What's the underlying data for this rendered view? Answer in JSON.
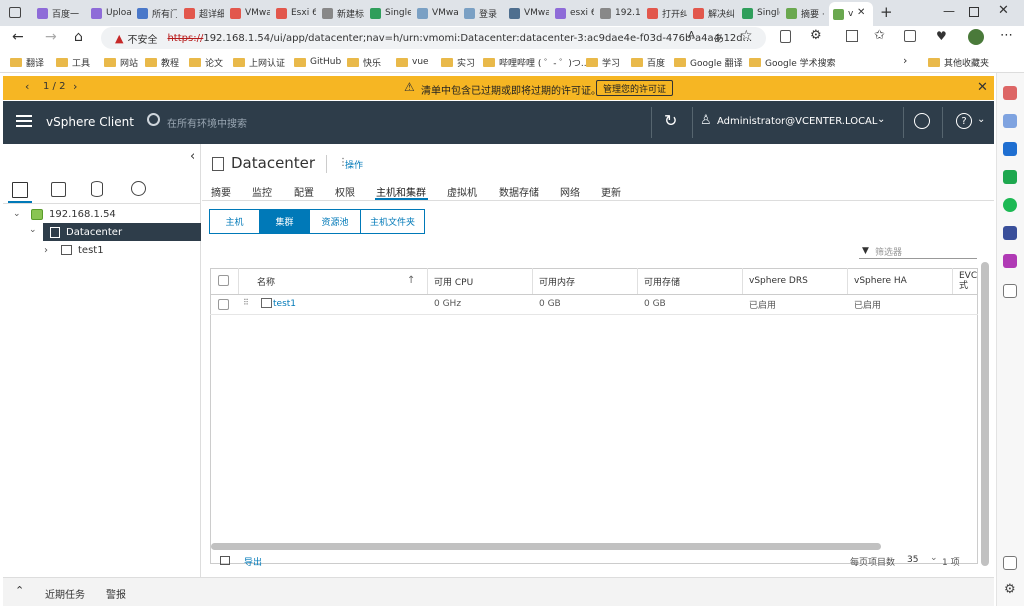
{
  "tabs": [
    {
      "label": "百度一",
      "color": "#8e6bd8"
    },
    {
      "label": "Uploa",
      "color": "#8e6bd8"
    },
    {
      "label": "所有门",
      "color": "#4a78c9"
    },
    {
      "label": "超详细",
      "color": "#e2574c"
    },
    {
      "label": "VMwa",
      "color": "#e2574c"
    },
    {
      "label": "Esxi 6",
      "color": "#e2574c"
    },
    {
      "label": "新建标",
      "color": "#888888"
    },
    {
      "label": "Single",
      "color": "#2f9e5b"
    },
    {
      "label": "VMwa",
      "color": "#7aa0c4"
    },
    {
      "label": "登录",
      "color": "#7aa0c4"
    },
    {
      "label": "VMwa",
      "color": "#4f6f8f"
    },
    {
      "label": "esxi 6",
      "color": "#8e6bd8"
    },
    {
      "label": "192.1c",
      "color": "#888888"
    },
    {
      "label": "打开纠",
      "color": "#e2574c"
    },
    {
      "label": "解决纠",
      "color": "#e2574c"
    },
    {
      "label": "Single",
      "color": "#2f9e5b"
    },
    {
      "label": "摘要 ·",
      "color": "#6aa84f"
    },
    {
      "label": "v",
      "color": "#6aa84f"
    }
  ],
  "address": {
    "warning": "不安全",
    "url_prefix": "https://",
    "url": "192.168.1.54/ui/app/datacenter;nav=h/urn:vmomi:Datacenter:datacenter-3:ac9dae4e-f03d-476b-a4a4-12d..."
  },
  "bookmarks": [
    "翻译",
    "工具",
    "网站",
    "教程",
    "论文",
    "上网认证",
    "GitHub",
    "快乐",
    "vue",
    "实习",
    "哔哩哔哩 ( ゜- ゜)つ...",
    "学习",
    "百度",
    "Google 翻译",
    "Google 学术搜索"
  ],
  "bookmarks_other": "其他收藏夹",
  "banner": {
    "pager": "1 / 2",
    "message": "清单中包含已过期或即将过期的许可证。",
    "button": "管理您的许可证"
  },
  "header": {
    "app": "vSphere Client",
    "search_placeholder": "在所有环境中搜索",
    "user": "Administrator@VCENTER.LOCAL"
  },
  "tree": {
    "host": "192.168.1.54",
    "datacenter": "Datacenter",
    "cluster": "test1"
  },
  "main": {
    "title": "Datacenter",
    "actions": "操作",
    "tabs": [
      "摘要",
      "监控",
      "配置",
      "权限",
      "主机和集群",
      "虚拟机",
      "数据存储",
      "网络",
      "更新"
    ],
    "subtabs": [
      "主机",
      "集群",
      "资源池",
      "主机文件夹"
    ],
    "filter": "筛选器",
    "columns": [
      "名称",
      "可用 CPU",
      "可用内存",
      "可用存储",
      "vSphere DRS",
      "vSphere HA",
      "EVC 式"
    ],
    "rows": [
      [
        "test1",
        "0 GHz",
        "0 GB",
        "0 GB",
        "已启用",
        "已启用"
      ]
    ],
    "export": "导出",
    "page_size_label": "每页项目数",
    "page_size": "35",
    "count": "1 项"
  },
  "bottom": {
    "recent": "近期任务",
    "alarms": "警报"
  },
  "colors": {
    "accent": "#0079b8",
    "header": "#2e3d4a",
    "banner": "#f6b623",
    "selected": "#2e3d4a"
  }
}
